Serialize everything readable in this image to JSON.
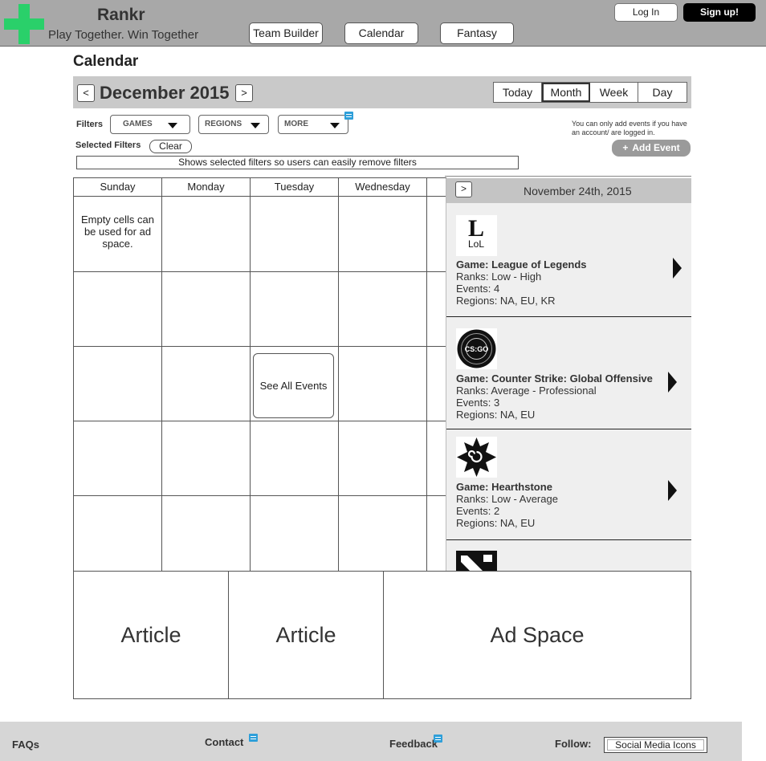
{
  "header": {
    "brand_name": "Rankr",
    "tagline": "Play Together. Win Together",
    "nav": [
      "Team Builder",
      "Calendar",
      "Fantasy"
    ],
    "login_label": "Log In",
    "signup_label": "Sign up!"
  },
  "page_title": "Calendar",
  "toolbar": {
    "prev_label": "<",
    "next_label": ">",
    "month_label": "December 2015",
    "views": [
      "Today",
      "Month",
      "Week",
      "Day"
    ],
    "active_view": "Month"
  },
  "filters": {
    "label": "Filters",
    "dropdowns": [
      "GAMES",
      "REGIONS",
      "MORE"
    ],
    "selected_label": "Selected Filters",
    "clear_label": "Clear",
    "selected_placeholder": "Shows selected filters so users can easily remove filters",
    "info_note": "You can only add events if you have an account/ are logged in.",
    "add_event_label": "Add Event"
  },
  "calendar": {
    "day_headers": [
      "Sunday",
      "Monday",
      "Tuesday",
      "Wednesday"
    ],
    "empty_note": "Empty cells can be used for ad space.",
    "see_all_label": "See All Events"
  },
  "side_panel": {
    "next_label": ">",
    "date": "November 24th, 2015",
    "games": [
      {
        "logo": "lol-logo",
        "logo_text": "LoL",
        "name": "Game: League of Legends",
        "ranks": "Ranks: Low - High",
        "events": "Events: 4",
        "regions": "Regions: NA, EU, KR"
      },
      {
        "logo": "csgo-logo",
        "logo_text": "CS:GO",
        "name": "Game: Counter Strike: Global Offensive",
        "ranks": "Ranks: Average - Professional",
        "events": "Events: 3",
        "regions": "Regions: NA, EU"
      },
      {
        "logo": "hearthstone-logo",
        "name": "Game: Hearthstone",
        "ranks": "Ranks: Low - Average",
        "events": "Events: 2",
        "regions": "Regions: NA, EU"
      }
    ]
  },
  "tiles": [
    "Article",
    "Article",
    "Ad Space"
  ],
  "footer": {
    "faqs": "FAQs",
    "contact": "Contact",
    "feedback": "Feedback",
    "follow": "Follow:",
    "social": "Social Media Icons"
  },
  "colors": {
    "logo_green": "#2ad06a",
    "header_bg": "#a8a8a8",
    "note_icon": "#2e9fd9"
  }
}
